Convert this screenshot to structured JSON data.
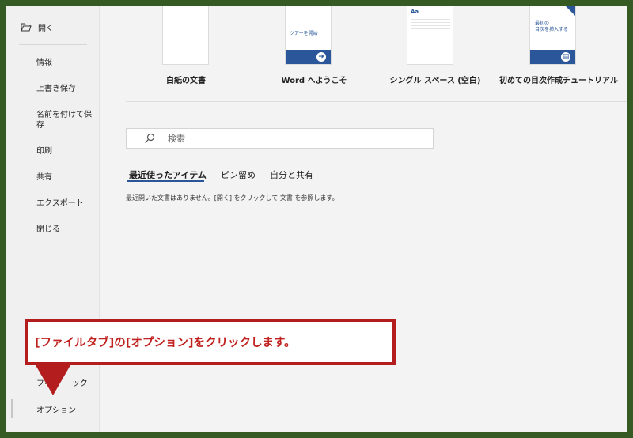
{
  "sidebar": {
    "open": "開く",
    "items": [
      "情報",
      "上書き保存",
      "名前を付けて保存",
      "印刷",
      "共有",
      "エクスポート",
      "閉じる"
    ],
    "feedback_partial": "フィー",
    "feedback_tail": "ック",
    "options": "オプション"
  },
  "templates": [
    {
      "label": "白紙の文書",
      "thumb": "blank"
    },
    {
      "label": "Word へようこそ",
      "thumb_text": "ツアーを開始"
    },
    {
      "label": "シングル スペース (空白)",
      "thumb_text": "Aa"
    },
    {
      "label": "初めての目次作成チュートリアル",
      "thumb_text": "最初の\n目次を挿入する"
    }
  ],
  "search": {
    "placeholder": "検索"
  },
  "tabs": [
    "最近使ったアイテム",
    "ピン留め",
    "自分と共有"
  ],
  "empty_message": "最近開いた文書はありません。[開く] をクリックして 文書 を参照します。",
  "callout": {
    "text": "[ファイルタブ]の[オプション]をクリックします。"
  },
  "colors": {
    "accent": "#2b579a",
    "callout_red": "#b31d1d",
    "frame_green": "#355a23"
  }
}
